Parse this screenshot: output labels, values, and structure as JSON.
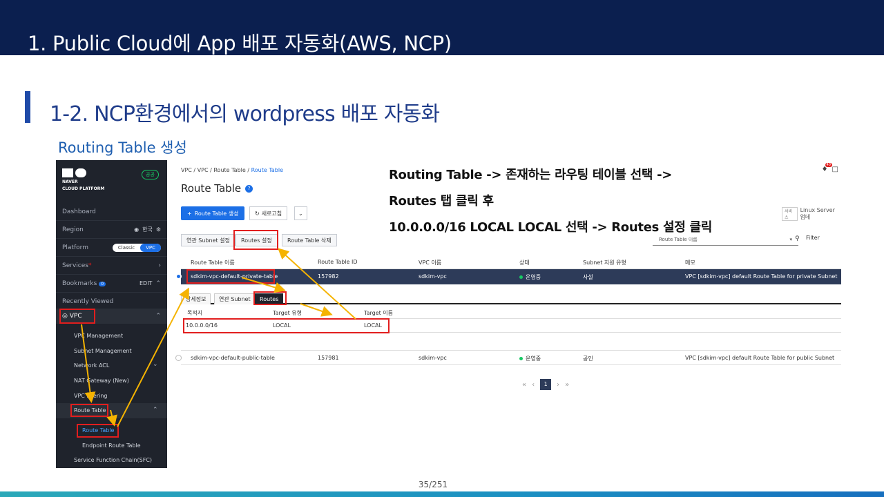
{
  "slide": {
    "title": "1. Public Cloud에 App 배포 자동화(AWS, NCP)",
    "section_title": "1-2. NCP환경에서의 wordpress 배포 자동화",
    "sub_title": "Routing Table 생성",
    "page_number": "35/251"
  },
  "callout": {
    "lines": [
      "Routing Table -> 존재하는 라우팅 테이블 선택 ->",
      "Routes 탭 클릭 후",
      "10.0.0.0/16 LOCAL LOCAL 선택 -> Routes 설정 클릭"
    ]
  },
  "sidebar": {
    "logo_line1": "NAVER",
    "logo_line2": "CLOUD PLATFORM",
    "env_badge": "공공",
    "dashboard": "Dashboard",
    "region_label": "Region",
    "region_value": "한국",
    "platform_label": "Platform",
    "platform_classic": "Classic",
    "platform_vpc": "VPC",
    "services": "Services",
    "bookmarks": "Bookmarks",
    "bookmarks_count": "0",
    "bookmarks_edit": "EDIT",
    "recently_viewed": "Recently Viewed",
    "vpc": "VPC",
    "items": [
      "VPC Management",
      "Subnet Management",
      "Network ACL",
      "NAT Gateway (New)",
      "VPC Peering",
      "Route Table",
      "Route Table",
      "Endpoint Route Table",
      "Service Function Chain(SFC)"
    ]
  },
  "main": {
    "breadcrumb": [
      "VPC",
      "VPC",
      "Route Table",
      "Route Table"
    ],
    "page_title": "Route Table",
    "notif_count": "40",
    "create_button": "Route Table 생성",
    "refresh_button": "새로고침",
    "service_tag": "서비스",
    "service_value": "Linux Server 업데",
    "action_tabs": [
      "연관 Subnet 설정",
      "Routes 설정",
      "Route Table 삭제"
    ],
    "filter_select": "Route Table 이름",
    "filter_button": "Filter",
    "columns": [
      "Route Table 이름",
      "Route Table ID",
      "VPC 이름",
      "상태",
      "Subnet 지원 유형",
      "메모"
    ],
    "rows": [
      {
        "name": "sdkim-vpc-default-private-table",
        "id": "157982",
        "vpc": "sdkim-vpc",
        "status": "운영중",
        "subnet_type": "사설",
        "memo": "VPC [sdkim-vpc] default Route Table for private Subnet"
      },
      {
        "name": "sdkim-vpc-default-public-table",
        "id": "157981",
        "vpc": "sdkim-vpc",
        "status": "운영중",
        "subnet_type": "공인",
        "memo": "VPC [sdkim-vpc] default Route Table for public Subnet"
      }
    ],
    "detail_tabs": [
      "상세정보",
      "연관 Subnet",
      "Routes"
    ],
    "routes_columns": [
      "목적지",
      "Target 유형",
      "Target 이름"
    ],
    "routes_row": [
      "10.0.0.0/16",
      "LOCAL",
      "LOCAL"
    ],
    "current_page": "1"
  },
  "colors": {
    "header_navy": "#0b1f4f",
    "accent_blue": "#1c6fe6",
    "sidebar_bg": "#1f232c",
    "highlight_red": "#e21e1e",
    "arrow_yellow": "#f5b301"
  }
}
